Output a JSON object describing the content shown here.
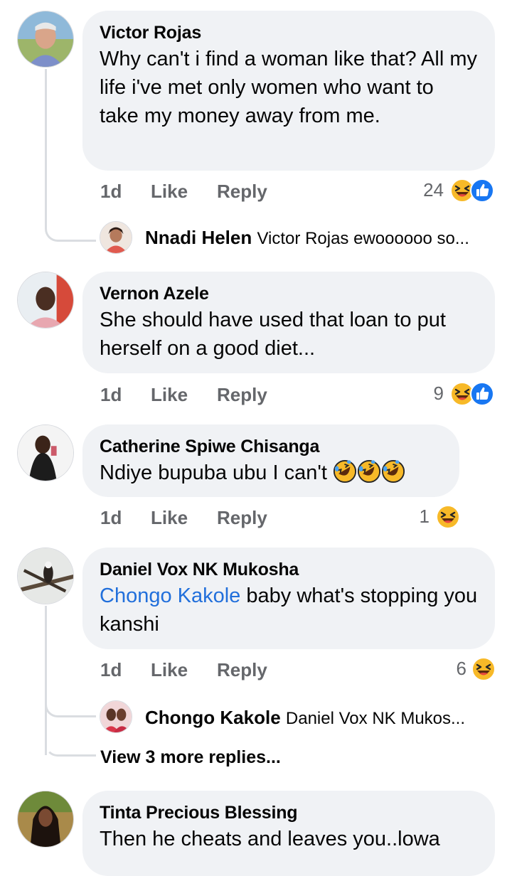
{
  "comments": [
    {
      "name": "Victor Rojas",
      "text": "Why can't i find a woman like that? All my life i've met only women who want to take my money away from me.",
      "time": "1d",
      "like": "Like",
      "reply": "Reply",
      "reaction_count": "24",
      "reactions": [
        "laugh-icon",
        "like-icon"
      ],
      "reply_preview": {
        "name": "Nnadi Helen",
        "text": "Victor Rojas ewoooooo so..."
      }
    },
    {
      "name": "Vernon Azele",
      "text": "She should have used that loan to put herself on a good diet...",
      "time": "1d",
      "like": "Like",
      "reply": "Reply",
      "reaction_count": "9",
      "reactions": [
        "laugh-icon",
        "like-icon"
      ]
    },
    {
      "name": "Catherine Spiwe Chisanga",
      "text": "Ndiye bupuba ubu I can't",
      "text_emojis": [
        "rofl-icon",
        "rofl-icon",
        "rofl-icon"
      ],
      "time": "1d",
      "like": "Like",
      "reply": "Reply",
      "reaction_count": "1",
      "reactions": [
        "laugh-icon"
      ]
    },
    {
      "name": "Daniel Vox NK Mukosha",
      "mention": "Chongo Kakole",
      "text": " baby what's stopping you kanshi",
      "time": "1d",
      "like": "Like",
      "reply": "Reply",
      "reaction_count": "6",
      "reactions": [
        "laugh-icon"
      ],
      "reply_preview": {
        "name": "Chongo Kakole",
        "text": "Daniel Vox NK Mukos..."
      },
      "more_replies": "View 3 more replies..."
    },
    {
      "name": "Tinta Precious Blessing",
      "text": "Then he cheats and leaves you..lowa"
    }
  ],
  "colors": {
    "bubble": "#f0f2f5",
    "meta": "#65676b",
    "mention": "#216fdb",
    "like_blue": "#1877f2",
    "laugh_yellow": "#f7b928"
  }
}
